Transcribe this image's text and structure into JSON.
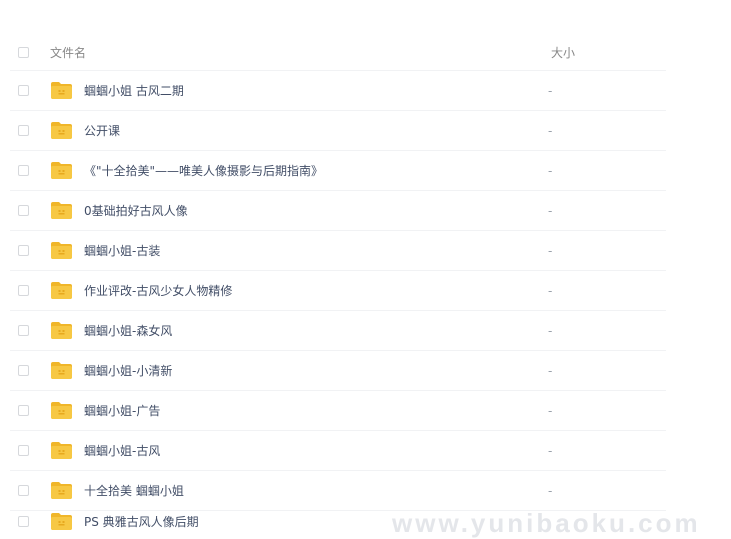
{
  "columns": {
    "name": "文件名",
    "size": "大小"
  },
  "files": [
    {
      "name": "蝈蝈小姐 古风二期",
      "size": "-"
    },
    {
      "name": "公开课",
      "size": "-"
    },
    {
      "name": "《\"十全拾美\"——唯美人像摄影与后期指南》",
      "size": "-"
    },
    {
      "name": "0基础拍好古风人像",
      "size": "-"
    },
    {
      "name": "蝈蝈小姐-古装",
      "size": "-"
    },
    {
      "name": "作业评改-古风少女人物精修",
      "size": "-"
    },
    {
      "name": "蝈蝈小姐-森女风",
      "size": "-"
    },
    {
      "name": "蝈蝈小姐-小清新",
      "size": "-"
    },
    {
      "name": "蝈蝈小姐-广告",
      "size": "-"
    },
    {
      "name": "蝈蝈小姐-古风",
      "size": "-"
    },
    {
      "name": "十全拾美 蝈蝈小姐",
      "size": "-"
    },
    {
      "name": "PS 典雅古风人像后期",
      "size": ""
    }
  ],
  "watermark": "www.yunibaoku.com",
  "colors": {
    "folder": "#f7c844",
    "folder_dark": "#f0b62a",
    "text": "#424e67",
    "header_text": "#888888",
    "divider": "#f1f2f4"
  },
  "icons": {
    "folder": "folder-icon",
    "checkbox": "checkbox"
  }
}
